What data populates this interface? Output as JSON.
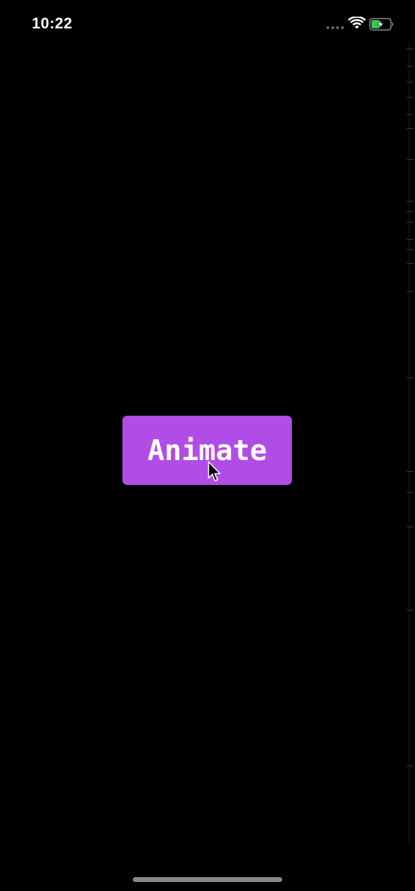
{
  "status_bar": {
    "time": "10:22",
    "icons": [
      "cellular-signal-icon",
      "wifi-icon",
      "battery-charging-icon"
    ],
    "battery_color": "#34c759"
  },
  "main": {
    "button_label": "Animate",
    "button_color": "#b24ce6"
  },
  "cursor": {
    "icon": "mouse-pointer-icon"
  }
}
